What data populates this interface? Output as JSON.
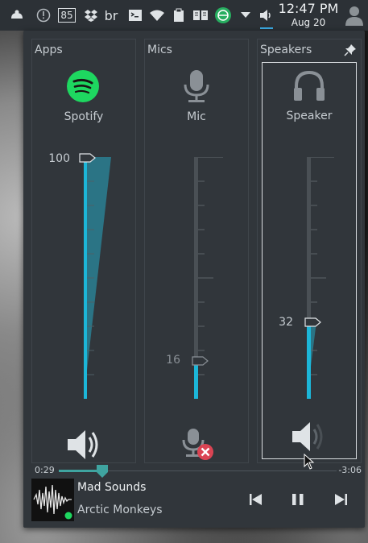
{
  "taskbar": {
    "badge_number": "85",
    "keyboard_layout": "br",
    "clock_time": "12:47 PM",
    "clock_date": "Aug 20",
    "icons": [
      "kde-connect-icon",
      "notifications-icon",
      "update-count-icon",
      "dropbox-icon",
      "keyboard-layout-icon",
      "terminal-icon",
      "wifi-icon",
      "clipboard-icon",
      "reader-icon",
      "network-manager-icon",
      "expand-tray-icon",
      "volume-icon",
      "user-icon"
    ]
  },
  "columns": {
    "apps": {
      "title": "Apps",
      "device": "Spotify",
      "volume": 100,
      "volume_label": "100",
      "muted": false
    },
    "mics": {
      "title": "Mics",
      "device": "Mic",
      "volume": 16,
      "volume_label": "16",
      "muted": true
    },
    "speakers": {
      "title": "Speakers",
      "device": "Speaker",
      "volume": 32,
      "volume_label": "32",
      "muted": false
    }
  },
  "player": {
    "elapsed": "0:29",
    "remaining": "-3:06",
    "progress": 0.14,
    "title": "Mad Sounds",
    "artist": "Arctic Monkeys"
  },
  "colors": {
    "accent": "#1cb6d8",
    "panel": "#31363b",
    "spotify": "#1ed760",
    "mute_red": "#da4453"
  }
}
